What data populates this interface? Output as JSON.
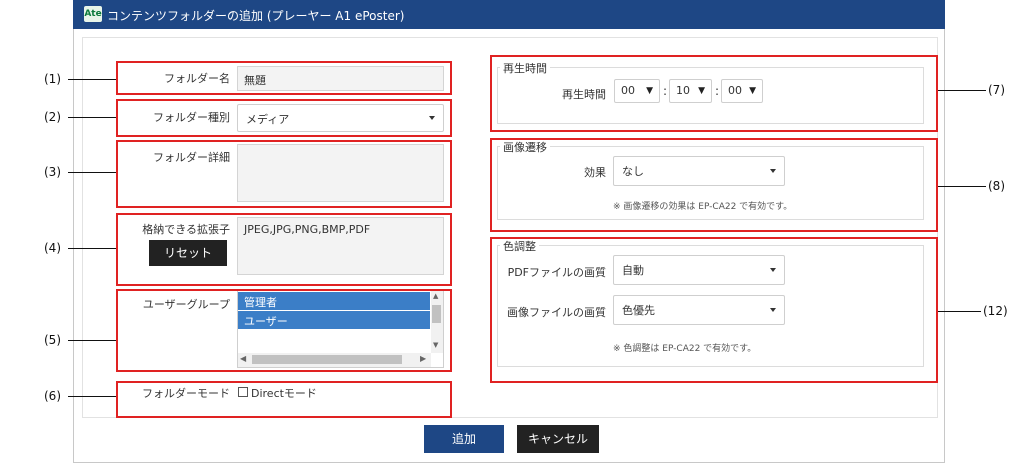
{
  "window": {
    "app_icon": "Ate",
    "title": "コンテンツフォルダーの追加 (プレーヤー A1 ePoster)"
  },
  "form": {
    "folder_name": {
      "label": "フォルダー名",
      "value": "無題"
    },
    "folder_type": {
      "label": "フォルダー種別",
      "value": "メディア"
    },
    "folder_detail": {
      "label": "フォルダー詳細",
      "value": ""
    },
    "extensions": {
      "label": "格納できる拡張子",
      "value": "JPEG,JPG,PNG,BMP,PDF",
      "reset_label": "リセット"
    },
    "user_group": {
      "label": "ユーザーグループ",
      "items": [
        "管理者",
        "ユーザー"
      ]
    },
    "folder_mode": {
      "label": "フォルダーモード",
      "checkbox_label": "Directモード",
      "checked": false
    }
  },
  "playback": {
    "legend": "再生時間",
    "label": "再生時間",
    "hours": "00",
    "minutes": "10",
    "seconds": "00"
  },
  "transition": {
    "legend": "画像遷移",
    "effect_label": "効果",
    "effect_value": "なし",
    "note": "※ 画像遷移の効果は EP-CA22 で有効です。"
  },
  "color": {
    "legend": "色調整",
    "pdf_label": "PDFファイルの画質",
    "pdf_value": "自動",
    "image_label": "画像ファイルの画質",
    "image_value": "色優先",
    "note": "※ 色調整は EP-CA22 で有効です。"
  },
  "actions": {
    "add_label": "追加",
    "cancel_label": "キャンセル"
  },
  "callouts": [
    "(1)",
    "(2)",
    "(3)",
    "(4)",
    "(5)",
    "(6)",
    "(7)",
    "(8)",
    "(12)"
  ],
  "colors": {
    "titlebar": "#1e4785",
    "highlight": "#e02222",
    "selection": "#3b7ec7"
  }
}
